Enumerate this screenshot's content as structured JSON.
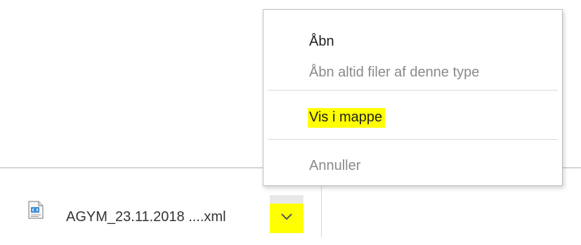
{
  "context_menu": {
    "items": [
      {
        "label": "Åbn",
        "enabled": true
      },
      {
        "label": "Åbn altid filer af denne type",
        "enabled": false
      },
      {
        "label": "Vis i mappe",
        "enabled": true,
        "highlighted": true
      },
      {
        "label": "Annuller",
        "enabled": false
      }
    ]
  },
  "download_shelf": {
    "file_name": "AGYM_23.11.2018 ....xml",
    "file_icon": "xml-file-icon",
    "menu_button_icon": "chevron-down-icon"
  },
  "colors": {
    "highlight": "#ffff00",
    "menu_border": "#bdbdbd",
    "disabled_text": "#8a8a8a"
  }
}
